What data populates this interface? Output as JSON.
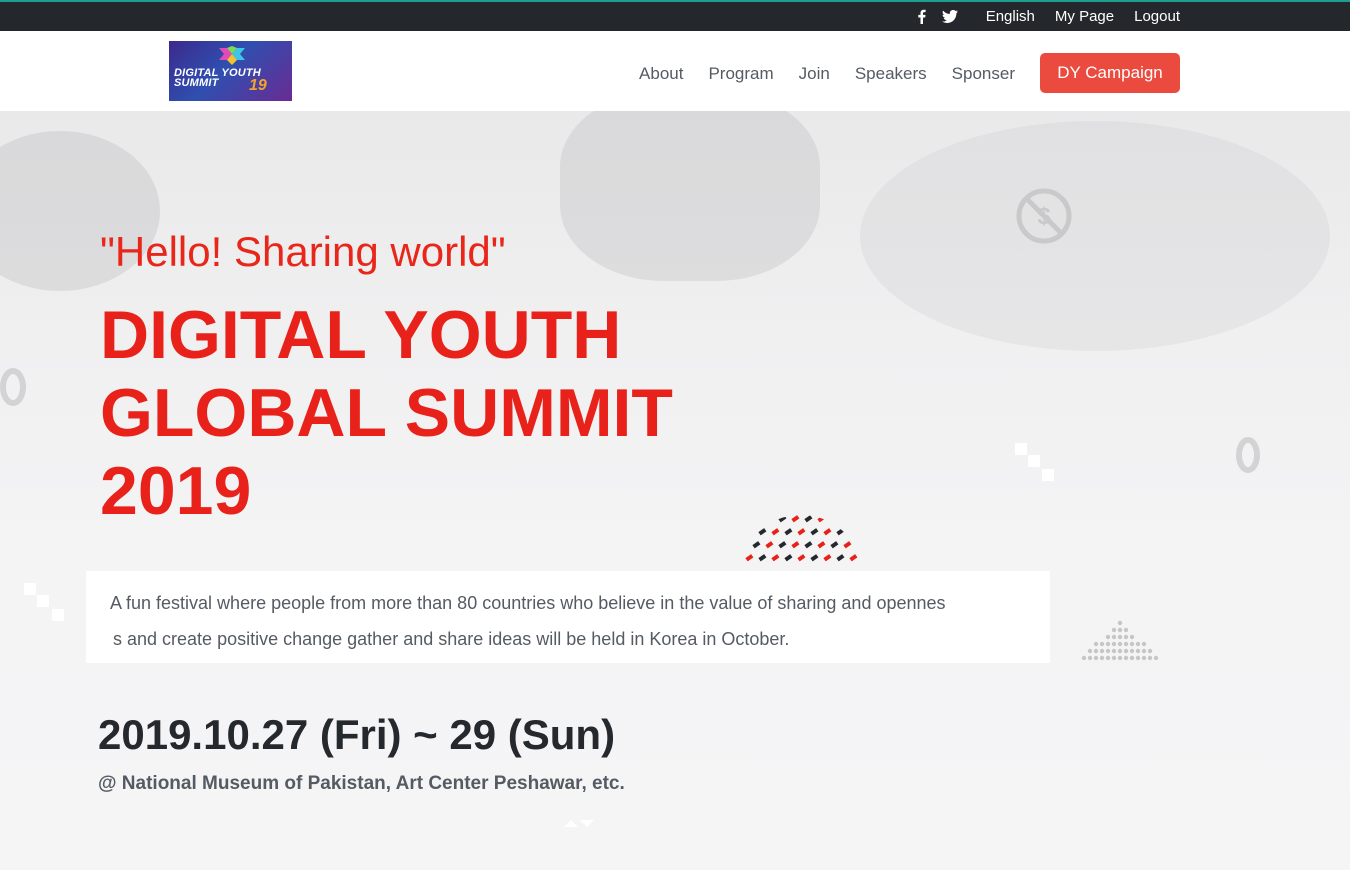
{
  "topbar": {
    "social": [
      {
        "name": "facebook-icon"
      },
      {
        "name": "twitter-icon"
      }
    ],
    "links": [
      "English",
      "My Page",
      "Logout"
    ]
  },
  "header": {
    "logo": {
      "line1": "DIGITAL YOUTH",
      "line2": "SUMMIT",
      "year": "19"
    },
    "nav": [
      "About",
      "Program",
      "Join",
      "Speakers",
      "Sponser"
    ],
    "cta_label": "DY Campaign"
  },
  "hero": {
    "tagline": "\"Hello! Sharing world\"",
    "title_lines": [
      "DIGITAL YOUTH",
      "GLOBAL SUMMIT",
      "2019"
    ],
    "description_lines": [
      "A fun festival where people from more than 80 countries who believe in the value of sharing and opennes",
      "s and create positive change gather and share ideas will be held in Korea in October."
    ],
    "date": "2019.10.27 (Fri) ~ 29 (Sun)",
    "venue": "@ National Museum of Pakistan, Art Center Peshawar, etc."
  },
  "colors": {
    "accent": "#e8221a",
    "cta": "#ea4b3e",
    "topbar": "#24272c",
    "text_dark": "#25282d",
    "text_muted": "#555b63"
  }
}
